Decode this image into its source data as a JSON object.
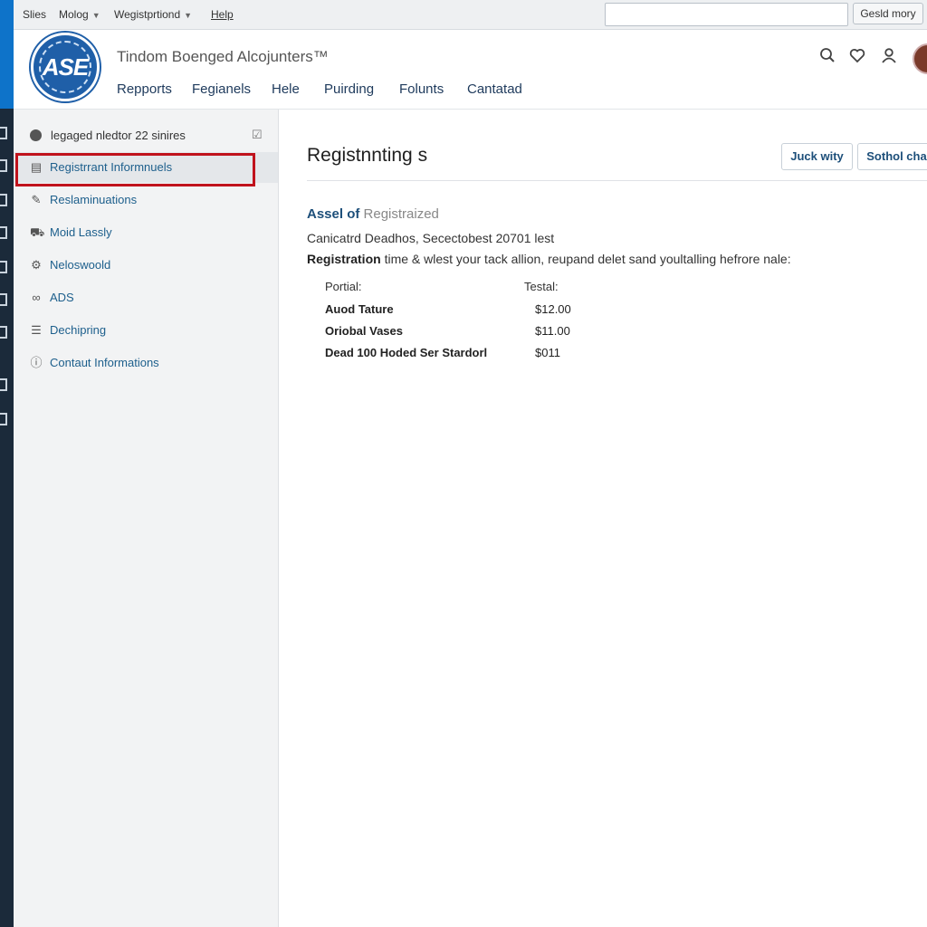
{
  "menubar": {
    "items": [
      "Slies",
      "Molog",
      "Wegistprtiond",
      "Help"
    ],
    "search_value": "",
    "button_label": "Gesld mory"
  },
  "header": {
    "logo_text": "ASE",
    "site_title": "Tindom Boenged Alcojunters™",
    "nav": [
      "Repports",
      "Fegianels",
      "Hele",
      "Puirding",
      "Folunts",
      "Cantatad"
    ]
  },
  "sidebar": {
    "heading": "legaged nledtor 22 sinires",
    "items": [
      {
        "label": "Registrrant Informnuels",
        "icon": "document-icon"
      },
      {
        "label": "Reslaminuations",
        "icon": "edit-icon"
      },
      {
        "label": "Moid Lassly",
        "icon": "car-icon"
      },
      {
        "label": "Neloswoold",
        "icon": "gear-icon"
      },
      {
        "label": "ADS",
        "icon": "link-icon"
      },
      {
        "label": "Dechipring",
        "icon": "list-icon"
      },
      {
        "label": "Contaut Informations",
        "icon": "info-icon"
      }
    ]
  },
  "main": {
    "title": "Registnnting s",
    "buttons": [
      "Juck wity",
      "Sothol cha"
    ],
    "section_title_bold": "Assel of",
    "section_title_rest": "Registraized",
    "line1": "Canicatrd Deadhos, Secectobest 20701 lest",
    "line2_bold": "Registration",
    "line2_rest": "time & wlest your tack allion, reupand delet sand youltalling hefrore nale:",
    "table": {
      "col1": "Portial:",
      "col2": "Testal:",
      "rows": [
        {
          "name": "Auod Tature",
          "value": "$12.00"
        },
        {
          "name": "Oriobal Vases",
          "value": "$11.00"
        },
        {
          "name": "Dead 100 Hoded Ser Stardorl",
          "value": "$011"
        }
      ]
    }
  },
  "colors": {
    "accent_blue": "#1f5fa8",
    "link": "#1d5f8c",
    "highlight": "#c0121c"
  }
}
